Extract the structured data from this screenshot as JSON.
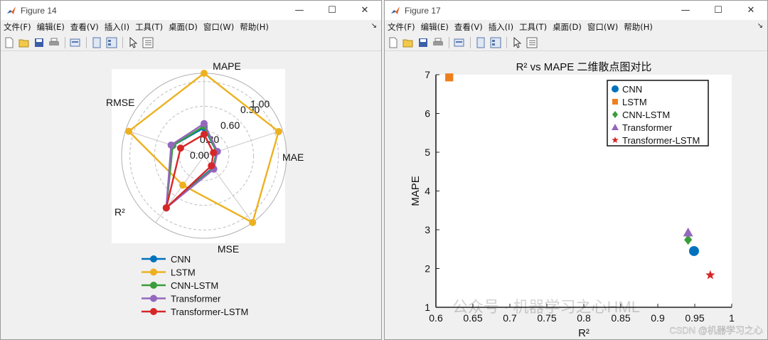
{
  "window1": {
    "title": "Figure 14",
    "menu": [
      "文件(F)",
      "编辑(E)",
      "查看(V)",
      "插入(I)",
      "工具(T)",
      "桌面(D)",
      "窗口(W)",
      "帮助(H)"
    ],
    "toolbar_icons": [
      "new-file-icon",
      "open-folder-icon",
      "save-icon",
      "print-icon",
      "print-preview-icon",
      "toggle-view-icon",
      "property-inspector-icon",
      "pointer-icon",
      "plot-browser-icon"
    ]
  },
  "window2": {
    "title": "Figure 17",
    "menu": [
      "文件(F)",
      "编辑(E)",
      "查看(V)",
      "插入(I)",
      "工具(T)",
      "桌面(D)",
      "窗口(W)",
      "帮助(H)"
    ],
    "toolbar_icons": [
      "new-file-icon",
      "open-folder-icon",
      "save-icon",
      "print-icon",
      "print-preview-icon",
      "toggle-view-icon",
      "property-inspector-icon",
      "pointer-icon",
      "plot-browser-icon"
    ]
  },
  "chart_data": [
    {
      "type": "radar",
      "title": "",
      "axes": [
        "MAPE",
        "MAE",
        "MSE",
        "R²",
        "RMSE"
      ],
      "radial_ticks": [
        "0.00",
        "0.30",
        "0.60",
        "0.90",
        "1.00"
      ],
      "range": [
        0,
        1
      ],
      "series": [
        {
          "name": "CNN",
          "color": "#0072BD",
          "values": [
            0.34,
            0.16,
            0.18,
            0.78,
            0.4
          ]
        },
        {
          "name": "LSTM",
          "color": "#EDB120",
          "values": [
            1.0,
            0.95,
            1.0,
            0.44,
            0.96
          ]
        },
        {
          "name": "CNN-LSTM",
          "color": "#3a9d3a",
          "values": [
            0.36,
            0.16,
            0.19,
            0.78,
            0.4
          ]
        },
        {
          "name": "Transformer",
          "color": "#9467BD",
          "values": [
            0.39,
            0.17,
            0.2,
            0.78,
            0.42
          ]
        },
        {
          "name": "Transformer-LSTM",
          "color": "#D62728",
          "values": [
            0.26,
            0.12,
            0.15,
            0.78,
            0.3
          ]
        }
      ],
      "legend_position": "bottom"
    },
    {
      "type": "scatter",
      "title": "R² vs MAPE 二维散点图对比",
      "xlabel": "R²",
      "ylabel": "MAPE",
      "xlim": [
        0.6,
        1.0
      ],
      "ylim": [
        1,
        7
      ],
      "xticks": [
        "0.6",
        "0.65",
        "0.7",
        "0.75",
        "0.8",
        "0.85",
        "0.9",
        "0.95",
        "1"
      ],
      "yticks": [
        "1",
        "2",
        "3",
        "4",
        "5",
        "6",
        "7"
      ],
      "series": [
        {
          "name": "CNN",
          "color": "#0072BD",
          "marker": "circle",
          "x": 0.949,
          "y": 2.45
        },
        {
          "name": "LSTM",
          "color": "#EE7F1E",
          "marker": "square",
          "x": 0.618,
          "y": 6.93
        },
        {
          "name": "CNN-LSTM",
          "color": "#3a9d3a",
          "marker": "diamond",
          "x": 0.941,
          "y": 2.74
        },
        {
          "name": "Transformer",
          "color": "#9467BD",
          "marker": "triangle",
          "x": 0.941,
          "y": 2.93
        },
        {
          "name": "Transformer-LSTM",
          "color": "#D62728",
          "marker": "star",
          "x": 0.971,
          "y": 1.83
        }
      ],
      "legend_position": "top-right"
    }
  ],
  "watermark": "公众号 · 机器学习之心HML",
  "footer_credit": "CSDN @机器学习之心"
}
